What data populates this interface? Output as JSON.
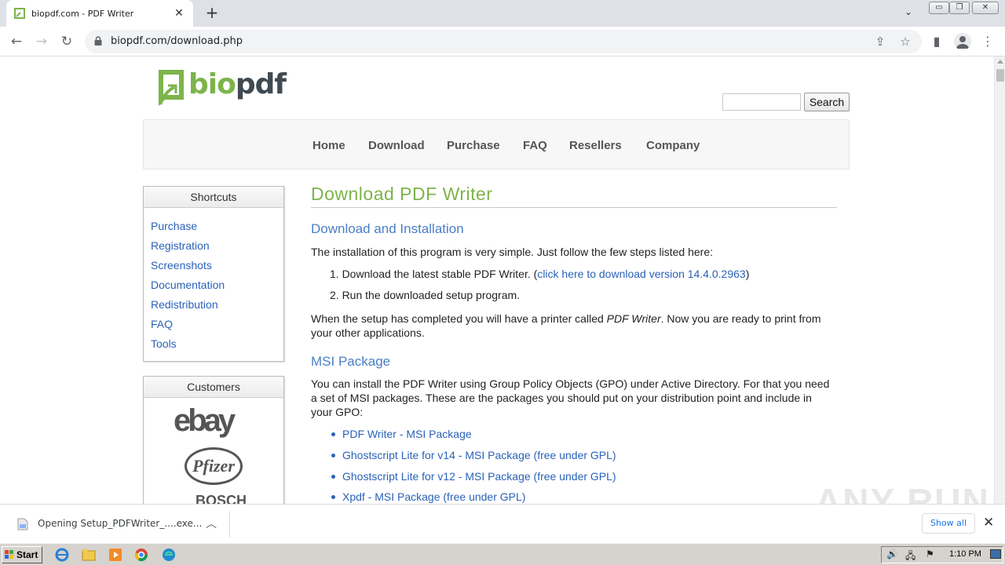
{
  "browser": {
    "tab_title": "biopdf.com - PDF Writer",
    "url": "biopdf.com/download.php"
  },
  "site": {
    "logo": {
      "part1": "bio",
      "part2": "pdf"
    },
    "search_button": "Search",
    "nav": [
      "Home",
      "Download",
      "Purchase",
      "FAQ",
      "Resellers",
      "Company"
    ]
  },
  "sidebar": {
    "shortcuts_title": "Shortcuts",
    "shortcuts": [
      "Purchase",
      "Registration",
      "Screenshots",
      "Documentation",
      "Redistribution",
      "FAQ",
      "Tools"
    ],
    "customers_title": "Customers",
    "customers": [
      "ebay",
      "Pfizer",
      "BOSCH"
    ]
  },
  "content": {
    "title": "Download PDF Writer",
    "section1_title": "Download and Installation",
    "intro": "The installation of this program is very simple. Just follow the few steps listed here:",
    "step1_text": "1. Download the latest stable PDF Writer. (",
    "step1_link": "click here to download version 14.4.0.2963",
    "step1_end": ")",
    "step2_text": "2. Run the downloaded setup program.",
    "after_pre": "When the setup has completed you will have a printer called ",
    "after_em": "PDF Writer",
    "after_post": ". Now you are ready to print from your other applications.",
    "section2_title": "MSI Package",
    "msi_intro": "You can install the PDF Writer using Group Policy Objects (GPO) under Active Directory. For that you need a set of MSI packages. These are the packages you should put on your distribution point and include in your GPO:",
    "msi_links": [
      "PDF Writer - MSI Package",
      "Ghostscript Lite for v14 - MSI Package (free under GPL)",
      "Ghostscript Lite for v12 - MSI Package (free under GPL)",
      "Xpdf - MSI Package (free under GPL)"
    ]
  },
  "download_bar": {
    "text": "Opening Setup_PDFWriter_....exe...",
    "show_all": "Show all"
  },
  "taskbar": {
    "start": "Start",
    "clock": "1:10 PM"
  },
  "watermark": "ANY RUN",
  "colors": {
    "brand_green": "#7cb44a",
    "link_blue": "#2a62b8",
    "heading_blue": "#4a7fc7"
  }
}
